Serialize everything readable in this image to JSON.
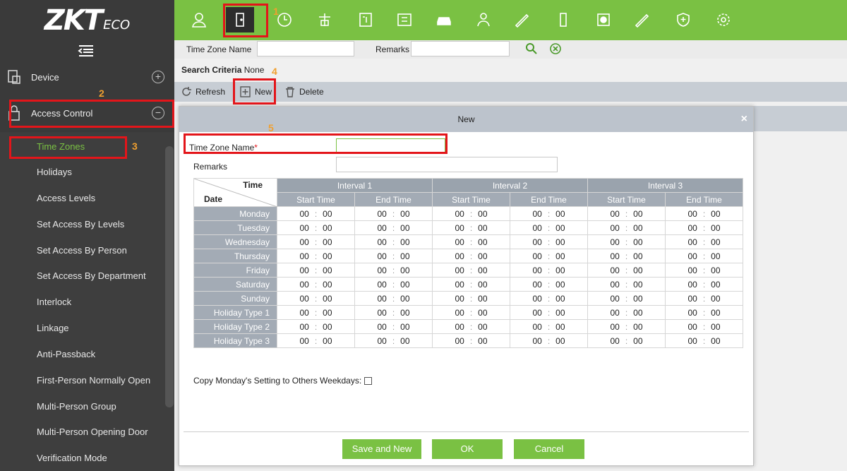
{
  "brand": {
    "logo_main": "ZKT",
    "logo_sub": "ECO"
  },
  "top_nav": {
    "icons": [
      "personnel-icon",
      "access-control-icon",
      "attendance-icon",
      "elevator-icon",
      "visitor-icon",
      "parking-icon",
      "car-icon",
      "patrol-icon",
      "pen-icon",
      "consumer-icon",
      "camera-icon",
      "pen-icon",
      "shield-icon",
      "settings-icon"
    ]
  },
  "annotations": {
    "n1": "1",
    "n2": "2",
    "n3": "3",
    "n4": "4",
    "n5": "5"
  },
  "sidebar": {
    "modules": [
      {
        "label": "Device",
        "toggle": "+"
      },
      {
        "label": "Access Control",
        "toggle": "−"
      }
    ],
    "items": [
      {
        "label": "Time Zones"
      },
      {
        "label": "Holidays"
      },
      {
        "label": "Access Levels"
      },
      {
        "label": "Set Access By Levels"
      },
      {
        "label": "Set Access By Person"
      },
      {
        "label": "Set Access By Department"
      },
      {
        "label": "Interlock"
      },
      {
        "label": "Linkage"
      },
      {
        "label": "Anti-Passback"
      },
      {
        "label": "First-Person Normally Open"
      },
      {
        "label": "Multi-Person Group"
      },
      {
        "label": "Multi-Person Opening Door"
      },
      {
        "label": "Verification Mode"
      }
    ]
  },
  "search": {
    "time_zone_name_label": "Time Zone Name",
    "time_zone_name_value": "",
    "remarks_label": "Remarks",
    "remarks_value": "",
    "criteria_label": "Search Criteria",
    "criteria_value": "None"
  },
  "toolbar": {
    "refresh": "Refresh",
    "new": "New",
    "delete": "Delete"
  },
  "dialog": {
    "title": "New",
    "close": "×",
    "tz_name_label": "Time Zone Name",
    "tz_name_required": "*",
    "tz_name_value": "",
    "remarks_label": "Remarks",
    "remarks_value": "",
    "header_time": "Time",
    "header_date": "Date",
    "intervals": [
      "Interval 1",
      "Interval 2",
      "Interval 3"
    ],
    "start_time": "Start Time",
    "end_time": "End Time",
    "days": [
      "Monday",
      "Tuesday",
      "Wednesday",
      "Thursday",
      "Friday",
      "Saturday",
      "Sunday",
      "Holiday Type 1",
      "Holiday Type 2",
      "Holiday Type 3"
    ],
    "hour_default": "00",
    "minute_default": "00",
    "separator": ":",
    "copy_label": "Copy Monday's Setting to Others Weekdays:",
    "copy_checked": false,
    "buttons": {
      "save_new": "Save and New",
      "ok": "OK",
      "cancel": "Cancel"
    }
  },
  "colors": {
    "brand_green": "#7ac143",
    "sidebar_dark": "#3a3a3a",
    "annotation_red": "#e3151a",
    "annotation_orange": "#f0a030"
  }
}
